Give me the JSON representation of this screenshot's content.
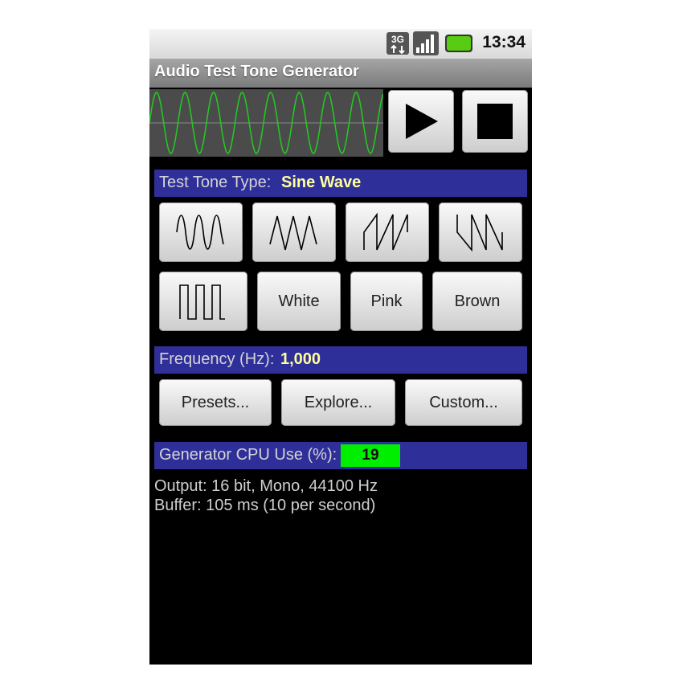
{
  "status_bar": {
    "time": "13:34",
    "icons": [
      "3g-data-icon",
      "signal-strength-icon",
      "battery-icon"
    ]
  },
  "app": {
    "title": "Audio Test Tone Generator"
  },
  "waveform_display": {
    "wave": "sine",
    "color": "#22cc22"
  },
  "controls": {
    "play_icon": "play-icon",
    "stop_icon": "stop-icon"
  },
  "tone_type": {
    "label": "Test Tone Type:",
    "value": "Sine Wave",
    "buttons_row1": [
      "sine-wave-icon",
      "triangle-wave-icon",
      "sawtooth-wave-icon",
      "reverse-sawtooth-wave-icon"
    ],
    "square_icon": "square-wave-icon",
    "noise_buttons": [
      "White",
      "Pink",
      "Brown"
    ]
  },
  "frequency": {
    "label": "Frequency (Hz):",
    "value": "1,000",
    "buttons": [
      "Presets...",
      "Explore...",
      "Custom..."
    ]
  },
  "cpu": {
    "label": "Generator CPU Use (%):",
    "value": "19",
    "color": "#00ee00"
  },
  "info": {
    "output": "Output: 16 bit, Mono, 44100 Hz",
    "buffer": "Buffer: 105 ms (10 per second)"
  },
  "colors": {
    "header_bg": "#2f2f9a",
    "header_value": "#ffff9a"
  }
}
